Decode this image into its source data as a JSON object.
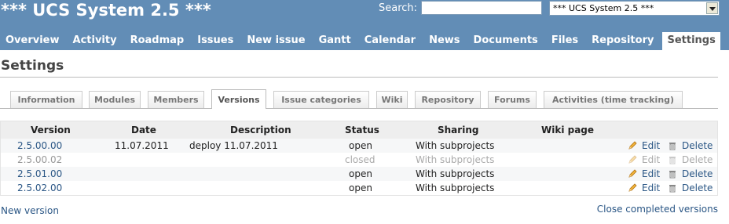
{
  "header": {
    "project_title": "*** UCS System 2.5 ***",
    "search_label": "Search:",
    "search_value": "",
    "project_jump_selected": "*** UCS System 2.5 ***"
  },
  "main_menu": [
    {
      "label": "Overview"
    },
    {
      "label": "Activity"
    },
    {
      "label": "Roadmap"
    },
    {
      "label": "Issues"
    },
    {
      "label": "New issue"
    },
    {
      "label": "Gantt"
    },
    {
      "label": "Calendar"
    },
    {
      "label": "News"
    },
    {
      "label": "Documents"
    },
    {
      "label": "Files"
    },
    {
      "label": "Repository"
    },
    {
      "label": "Settings",
      "selected": true
    }
  ],
  "page_title": "Settings",
  "tabs": [
    {
      "label": "Information"
    },
    {
      "label": "Modules"
    },
    {
      "label": "Members"
    },
    {
      "label": "Versions",
      "selected": true
    },
    {
      "label": "Issue categories"
    },
    {
      "label": "Wiki"
    },
    {
      "label": "Repository"
    },
    {
      "label": "Forums"
    },
    {
      "label": "Activities (time tracking)"
    }
  ],
  "versions_table": {
    "headers": {
      "version": "Version",
      "date": "Date",
      "description": "Description",
      "status": "Status",
      "sharing": "Sharing",
      "wiki_page": "Wiki page"
    },
    "rows": [
      {
        "version": "2.5.00.00",
        "date": "11.07.2011",
        "description": "deploy 11.07.2011",
        "status": "open",
        "sharing": "With subprojects",
        "edit": "Edit",
        "delete": "Delete"
      },
      {
        "version": "2.5.00.02",
        "date": "",
        "description": "",
        "status": "closed",
        "sharing": "With subprojects",
        "edit": "Edit",
        "delete": "Delete"
      },
      {
        "version": "2.5.01.00",
        "date": "",
        "description": "",
        "status": "open",
        "sharing": "With subprojects",
        "edit": "Edit",
        "delete": "Delete"
      },
      {
        "version": "2.5.02.00",
        "date": "",
        "description": "",
        "status": "open",
        "sharing": "With subprojects",
        "edit": "Edit",
        "delete": "Delete"
      }
    ]
  },
  "new_version_link": "New version",
  "close_completed_link": "Close completed versions",
  "colors": {
    "header_bg": "#628db6",
    "link": "#2a5685",
    "closed_text": "#aaaaaa"
  },
  "icons": {
    "edit": "pencil-icon",
    "delete": "trash-icon"
  }
}
